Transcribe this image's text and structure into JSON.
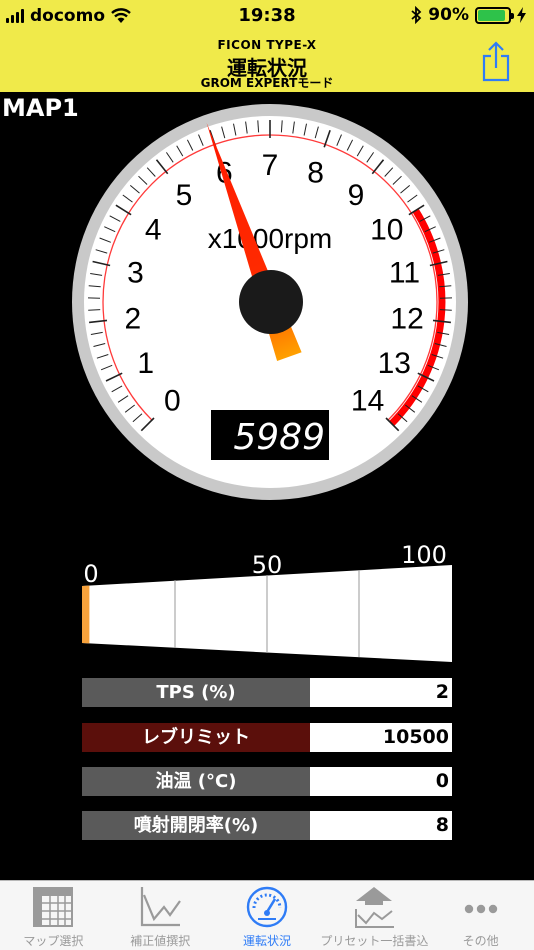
{
  "status_bar": {
    "carrier": "docomo",
    "time": "19:38",
    "battery": "90%",
    "battery_level": 0.9
  },
  "nav": {
    "subtitle": "FICON TYPE-X",
    "title": "運転状況",
    "mode": "GROM EXPERTモード"
  },
  "map_label": "MAP1",
  "gauge": {
    "unit_label": "x1000rpm",
    "ticks": [
      "0",
      "1",
      "2",
      "3",
      "4",
      "5",
      "6",
      "7",
      "8",
      "9",
      "10",
      "11",
      "12",
      "13",
      "14"
    ],
    "rpm_value": 5989,
    "rpm_display": "5989",
    "redzone_start": 10,
    "max": 14
  },
  "tps_bar": {
    "labels": [
      "0",
      "50",
      "100"
    ],
    "value": 2,
    "max": 100,
    "indicator_color": "#f7a23c"
  },
  "rows": [
    {
      "label": "TPS (%)",
      "value": "2",
      "color": "#5a5a5a"
    },
    {
      "label": "レブリミット",
      "value": "10500",
      "color": "#5b0f0b"
    },
    {
      "label": "油温 (°C)",
      "value": "0",
      "color": "#5a5a5a"
    },
    {
      "label": "噴射開閉率(%)",
      "value": "8",
      "color": "#5a5a5a"
    }
  ],
  "tabs": [
    {
      "label": "マップ選択",
      "icon": "grid-icon",
      "active": false
    },
    {
      "label": "補正値撰択",
      "icon": "line-chart-icon",
      "active": false
    },
    {
      "label": "運転状況",
      "icon": "speedometer-icon",
      "active": true
    },
    {
      "label": "プリセット一括書込",
      "icon": "upload-chart-icon",
      "active": false
    },
    {
      "label": "その他",
      "icon": "more-icon",
      "active": false
    }
  ],
  "colors": {
    "accent": "#f0ea4a",
    "redzone": "#ff0000",
    "tab_active": "#2f7cf6"
  }
}
